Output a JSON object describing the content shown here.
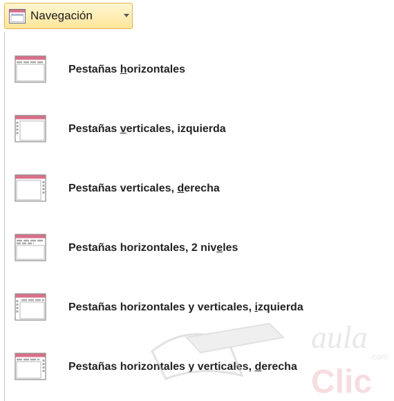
{
  "button": {
    "label": "Navegación",
    "icon": "navigation-form-icon",
    "arrow_icon": "dropdown-arrow-icon"
  },
  "menu": {
    "items": [
      {
        "label": "Pestañas horizontales",
        "icon": "tabs-horizontal-icon",
        "accel_before": "Pestañas ",
        "accel_char": "h",
        "accel_after": "orizontales"
      },
      {
        "label": "Pestañas verticales, izquierda",
        "icon": "tabs-vertical-left-icon",
        "accel_before": "Pestañas ",
        "accel_char": "v",
        "accel_after": "erticales, izquierda"
      },
      {
        "label": "Pestañas verticales, derecha",
        "icon": "tabs-vertical-right-icon",
        "accel_before": "Pestañas verticales, ",
        "accel_char": "d",
        "accel_after": "erecha"
      },
      {
        "label": "Pestañas horizontales, 2 niveles",
        "icon": "tabs-horizontal-2-levels-icon",
        "accel_before": "Pestañas horizontales, 2 niv",
        "accel_char": "e",
        "accel_after": "les"
      },
      {
        "label": "Pestañas horizontales y verticales, izquierda",
        "icon": "tabs-horizontal-vertical-left-icon",
        "accel_before": "Pestañas horizontales y verticales, ",
        "accel_char": "i",
        "accel_after": "zquierda"
      },
      {
        "label": "Pestañas horizontales y verticales, derecha",
        "icon": "tabs-horizontal-vertical-right-icon",
        "accel_before": "Pestañas horizontales y verticales, ",
        "accel_char": "d",
        "accel_after": "erecha"
      }
    ]
  },
  "watermark": {
    "text1": "aula",
    "text2": "Clic",
    "text3": ".com"
  },
  "colors": {
    "button_border": "#e3b44c",
    "button_bg": "#fde59a",
    "icon_header": "#d9708a",
    "icon_border": "#8a8a8a",
    "menu_border": "#c5c5c5"
  }
}
